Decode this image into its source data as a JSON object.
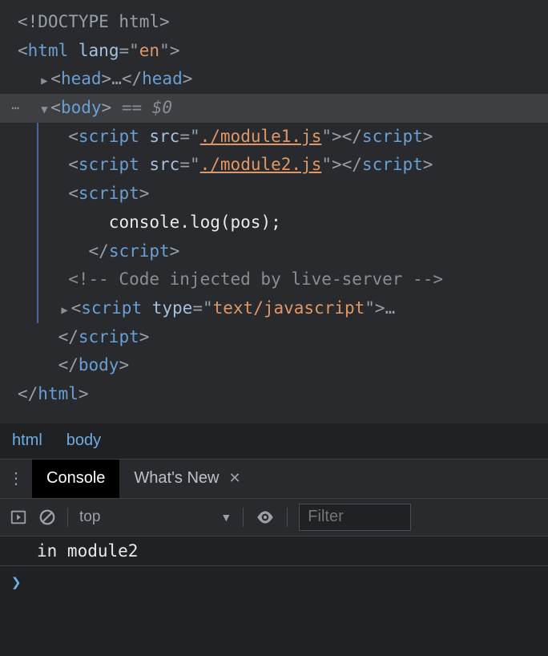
{
  "code": {
    "doctype": "<!DOCTYPE html>",
    "html_open_tag": "html",
    "html_attr_name": "lang",
    "html_attr_value": "en",
    "head_tag": "head",
    "head_ellipsis": "…",
    "body_tag": "body",
    "selection_hint": "== $0",
    "script_tag": "script",
    "src_attr": "src",
    "module1": "./module1.js",
    "module2": "./module2.js",
    "inline_code": "console.log(pos);",
    "comment": "<!-- Code injected by live-server -->",
    "type_attr": "type",
    "type_value": "text/javascript",
    "script_ellipsis": "…",
    "body_close": "body",
    "html_close": "html"
  },
  "breadcrumbs": [
    "html",
    "body"
  ],
  "tabs": {
    "active": "Console",
    "inactive": "What's New"
  },
  "toolbar": {
    "context": "top",
    "filter_placeholder": "Filter"
  },
  "console": {
    "output": "in module2",
    "prompt": "❯"
  }
}
